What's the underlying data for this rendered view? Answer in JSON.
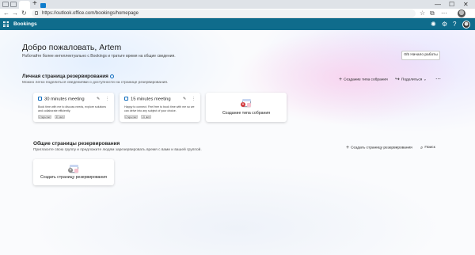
{
  "browser": {
    "url": "https://outlook.office.com/bookings/homepage",
    "tab_plus": "+",
    "minimize": "—",
    "maximize": "☐",
    "close": "✕",
    "back": "←",
    "forward": "→",
    "reload": "↻",
    "star": "☆",
    "extensions": "⧉",
    "menu": "⋯"
  },
  "app": {
    "title": "Bookings",
    "lightbulb": "✺",
    "settings": "⚙",
    "help": "?"
  },
  "welcome": {
    "heading": "Добро пожаловать, Artem",
    "subtitle": "Работайте более интеллектуально с Bookings и тратьте время на общие сведения.",
    "tasks_button": "0/5 Начало работы"
  },
  "personal": {
    "title": "Личная страница резервирования",
    "subtitle": "Можно легко поделиться сведениями о доступности на странице резервирования.",
    "create_meeting_type": "Создание типа собрания",
    "share": "Поделиться",
    "share_caret": "⌄",
    "more": "⋯",
    "cards": [
      {
        "title": "30 minutes meeting",
        "description": "Book time with me to discuss needs, explore solutions and collaborate efficiently.",
        "badge_access": "Открытые",
        "badge_duration": "30 мин"
      },
      {
        "title": "15 minutes meeting",
        "description": "Happy to connect. Feel free to book time with me so we can delve into any subject of your choice.",
        "badge_access": "Открытые",
        "badge_duration": "15 мин"
      }
    ],
    "create_card_label": "Создание типа собрания"
  },
  "shared": {
    "title": "Общие страницы резервирования",
    "subtitle": "Пригласите свою группу и предложите людям зарезервировать время с вами и вашей группой.",
    "create_page": "Создать страницу резервирования",
    "search": "Поиск",
    "create_card_label": "Создать страницу резервирования"
  }
}
